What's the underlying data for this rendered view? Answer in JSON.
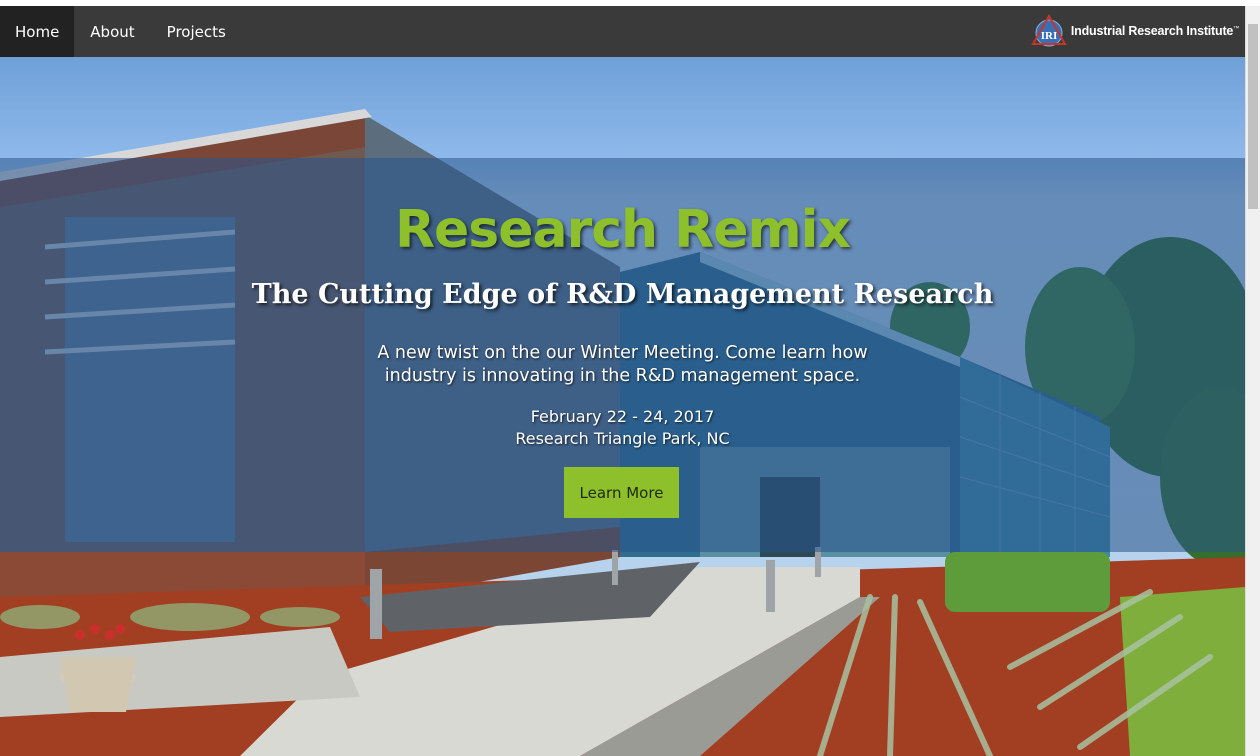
{
  "nav": {
    "items": [
      {
        "label": "Home",
        "active": true
      },
      {
        "label": "About",
        "active": false
      },
      {
        "label": "Projects",
        "active": false
      }
    ],
    "brand": {
      "logo_text": "IRI",
      "name": "Industrial Research Institute",
      "trademark": "™"
    }
  },
  "hero": {
    "title": "Research Remix",
    "subtitle": "The Cutting Edge of R&D Management Research",
    "description": "A new twist on the our Winter Meeting. Come learn how industry is innovating in the R&D management space.",
    "date": "February 22 - 24, 2017",
    "location": "Research Triangle Park, NC",
    "cta_label": "Learn More"
  },
  "colors": {
    "nav_background": "#3a3a3a",
    "nav_active": "#222222",
    "accent_green": "#8dc02b",
    "overlay_blue": "#26548c"
  }
}
